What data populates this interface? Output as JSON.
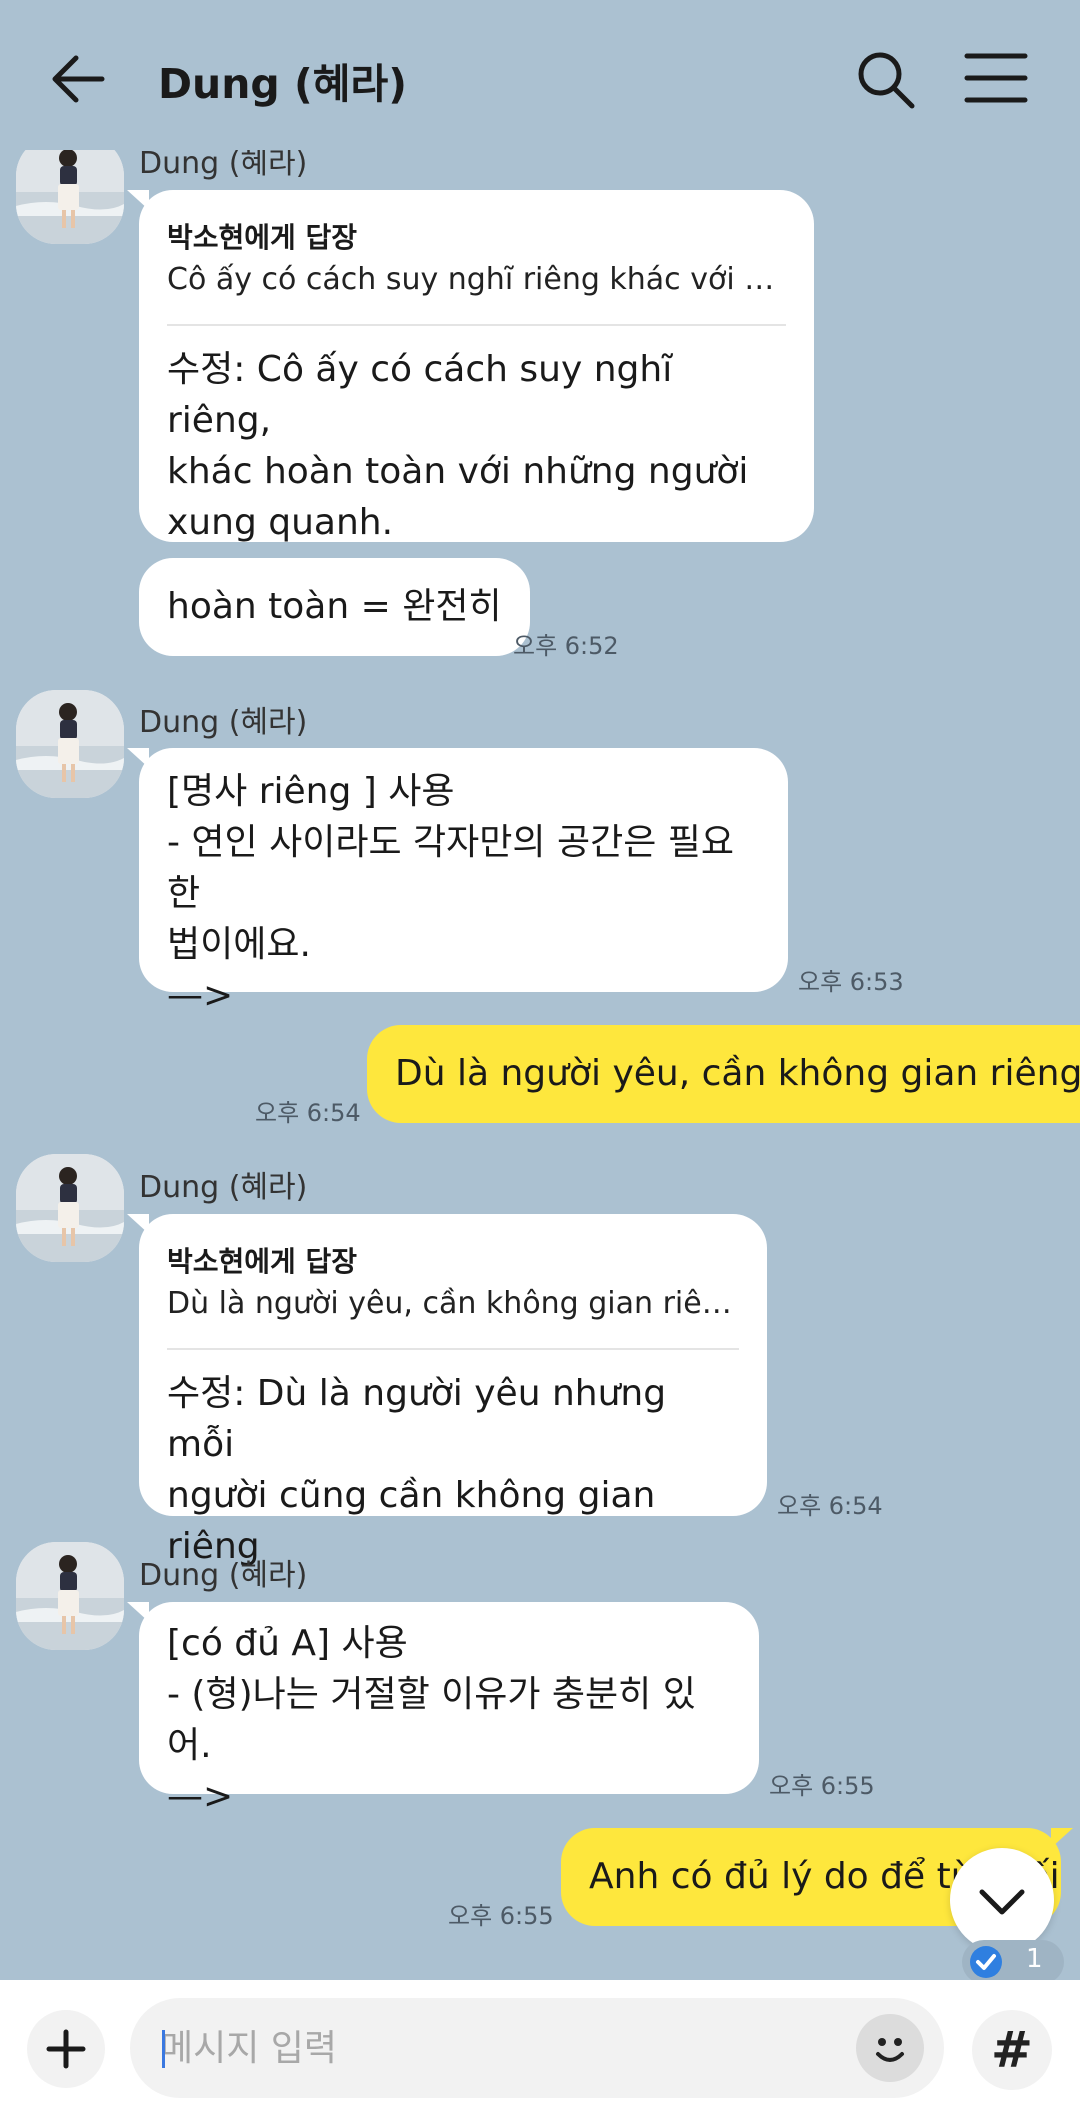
{
  "header": {
    "title": "Dung (혜라)",
    "back_icon": "arrow-left-icon",
    "search_icon": "search-icon",
    "menu_icon": "hamburger-menu-icon"
  },
  "messages": {
    "top_partial_name": "Dung (혜라)",
    "m1": {
      "reply_to": "박소현에게 답장",
      "quote": "Cô ấy có cách suy nghĩ riêng khác với n...",
      "text": "수정: Cô ấy có cách suy nghĩ riêng,\nkhác hoàn toàn với những người\nxung quanh."
    },
    "m2": {
      "text": "hoàn toàn = 완전히",
      "time": "오후 6:52"
    },
    "m3": {
      "sender": "Dung (혜라)",
      "text": "[명사 riêng ] 사용\n-  연인 사이라도 각자만의 공간은 필요한\n법이에요.\n—>",
      "time": "오후 6:53"
    },
    "m4": {
      "text": "Dù là người yêu, cần không gian riêng.",
      "time": "오후 6:54"
    },
    "m5": {
      "sender": "Dung (혜라)",
      "reply_to": "박소현에게 답장",
      "quote": "Dù là người yêu, cần không gian riêng.",
      "text": "수정: Dù là người yêu nhưng mỗi\nngười cũng cần không gian riêng",
      "time": "오후 6:54"
    },
    "m6": {
      "sender": "Dung (혜라)",
      "text": "[có đủ A] 사용\n-  (형)나는 거절할 이유가 충분히 있어.\n—>",
      "time": "오후 6:55"
    },
    "m7": {
      "text": "Anh có đủ lý do để từ chối",
      "time": "오후 6:55"
    }
  },
  "scroll_down_icon": "chevron-down-icon",
  "read_badge": {
    "count": "1",
    "icon": "check-icon"
  },
  "input": {
    "placeholder": "메시지 입력",
    "plus_icon": "plus-icon",
    "emoji_icon": "emoji-icon",
    "hash_label": "#"
  },
  "colors": {
    "background": "#abc1d1",
    "my_bubble": "#fee73d",
    "other_bubble": "#ffffff"
  }
}
